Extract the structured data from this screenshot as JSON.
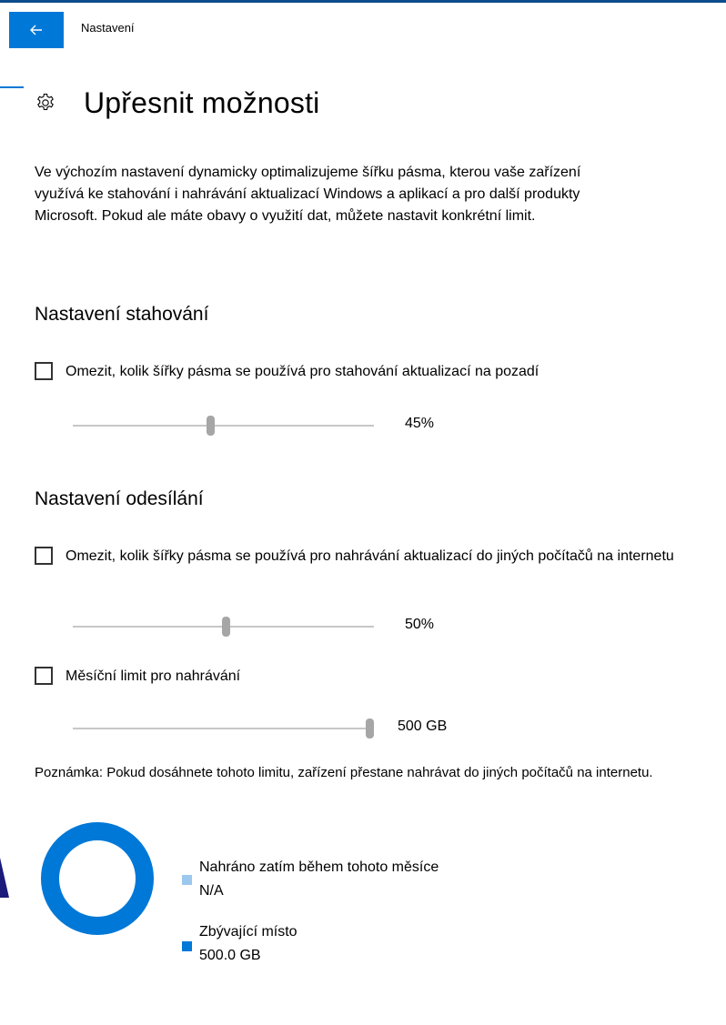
{
  "window": {
    "app_title": "Nastavení",
    "back_icon": "back-arrow-icon",
    "accent_color": "#0078d7"
  },
  "page": {
    "title": "Upřesnit možnosti",
    "title_icon": "gear-icon",
    "intro": "Ve výchozím nastavení dynamicky optimalizujeme šířku pásma, kterou vaše zařízení využívá ke stahování i nahrávání aktualizací Windows a aplikací a pro další produkty Microsoft. Pokud ale máte obavy o využití dat, můžete nastavit konkrétní limit."
  },
  "download_settings": {
    "heading": "Nastavení stahování",
    "limit_checkbox": {
      "label": "Omezit, kolik šířky pásma se používá pro stahování aktualizací na pozadí",
      "checked": false
    },
    "slider": {
      "value": 45,
      "value_label": "45%"
    }
  },
  "upload_settings": {
    "heading": "Nastavení odesílání",
    "limit_checkbox": {
      "label": "Omezit, kolik šířky pásma se používá pro nahrávání aktualizací do jiných počítačů na internetu",
      "checked": false
    },
    "slider": {
      "value": 50,
      "value_label": "50%"
    },
    "monthly_checkbox": {
      "label": "Měsíční limit pro nahrávání",
      "checked": false
    },
    "monthly_slider": {
      "value": 500,
      "max": 500,
      "value_label": "500 GB"
    }
  },
  "note": "Poznámka: Pokud dosáhnete tohoto limitu, zařízení přestane nahrávat do jiných počítačů na internetu.",
  "usage": {
    "uploaded": {
      "label": "Nahráno zatím během tohoto měsíce",
      "value": "N/A",
      "color": "#9dc8ee"
    },
    "remaining": {
      "label": "Zbývající místo",
      "value": "500.0 GB",
      "color": "#0078d7"
    },
    "ring_color": "#0078d7"
  }
}
